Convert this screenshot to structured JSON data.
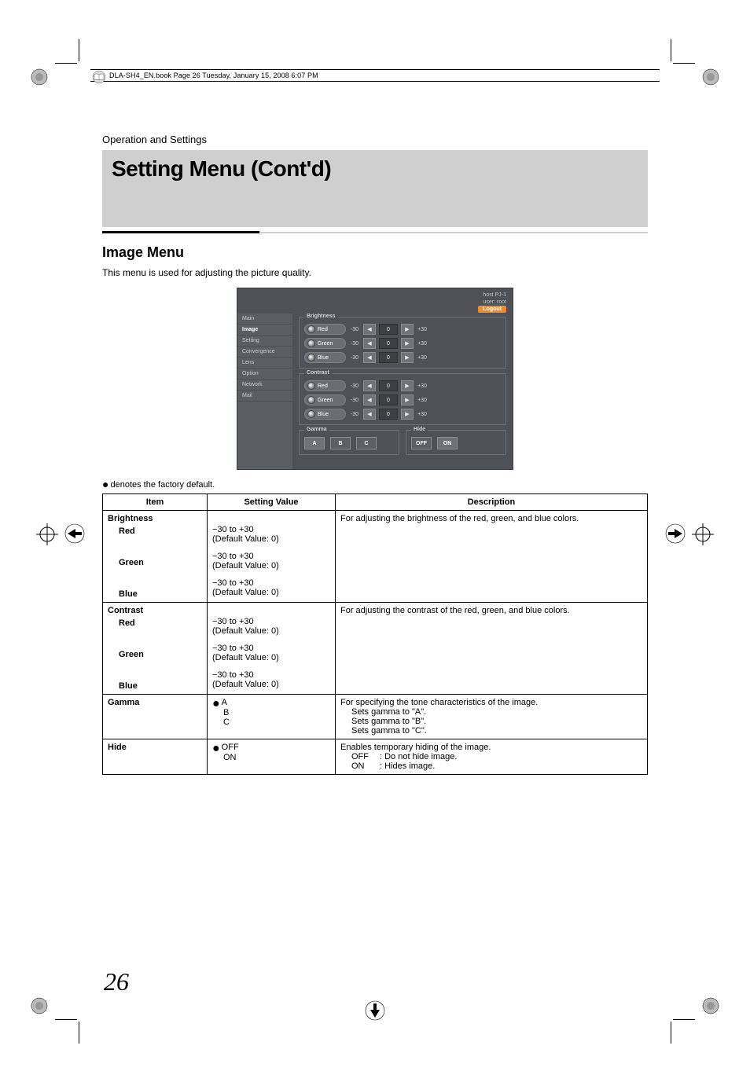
{
  "framemaker_header": "DLA-SH4_EN.book  Page 26  Tuesday, January 15, 2008  6:07 PM",
  "section_path": "Operation and Settings",
  "title": "Setting Menu (Cont'd)",
  "sub_heading": "Image Menu",
  "intro": "This menu is used for adjusting the picture quality.",
  "ui": {
    "host_line1": "host PJ-1",
    "host_line2": "user: root",
    "logout": "Logout",
    "side_items": [
      "Main",
      "Image",
      "Setting",
      "Convergence",
      "Lens",
      "Option",
      "Network",
      "Mail"
    ],
    "side_active_index": 1,
    "group_brightness": "Brightness",
    "group_contrast": "Contrast",
    "group_gamma": "Gamma",
    "group_hide": "Hide",
    "rows": {
      "red": "Red",
      "green": "Green",
      "blue": "Blue"
    },
    "range_min": "-30",
    "range_max": "+30",
    "value_zero": "0",
    "gamma_options": [
      "A",
      "B",
      "C"
    ],
    "hide_options": [
      "OFF",
      "ON"
    ]
  },
  "legend_note": "denotes the factory default.",
  "table": {
    "headers": {
      "item": "Item",
      "value": "Setting Value",
      "desc": "Description"
    },
    "brightness": {
      "label": "Brightness",
      "desc": "For adjusting the brightness of the red, green, and blue colors.",
      "red": {
        "label": "Red",
        "range": "−30 to +30",
        "default": "(Default Value: 0)"
      },
      "green": {
        "label": "Green",
        "range": "−30 to +30",
        "default": "(Default Value: 0)"
      },
      "blue": {
        "label": "Blue",
        "range": "−30 to +30",
        "default": "(Default Value: 0)"
      }
    },
    "contrast": {
      "label": "Contrast",
      "desc": "For adjusting the contrast of the red, green, and blue colors.",
      "red": {
        "label": "Red",
        "range": "−30 to +30",
        "default": "(Default Value: 0)"
      },
      "green": {
        "label": "Green",
        "range": "−30 to +30",
        "default": "(Default Value: 0)"
      },
      "blue": {
        "label": "Blue",
        "range": "−30 to +30",
        "default": "(Default Value: 0)"
      }
    },
    "gamma": {
      "label": "Gamma",
      "optA": "A",
      "optB": "B",
      "optC": "C",
      "desc_main": "For specifying the tone characteristics of the image.",
      "desc_a": "Sets gamma to \"A\".",
      "desc_b": "Sets gamma to \"B\".",
      "desc_c": "Sets gamma to \"C\"."
    },
    "hide": {
      "label": "Hide",
      "optOff": "OFF",
      "optOn": "ON",
      "desc_main": "Enables temporary hiding of the image.",
      "off_k": "OFF",
      "off_v": ": Do not hide image.",
      "on_k": "ON",
      "on_v": ": Hides image."
    }
  },
  "page_number": "26"
}
